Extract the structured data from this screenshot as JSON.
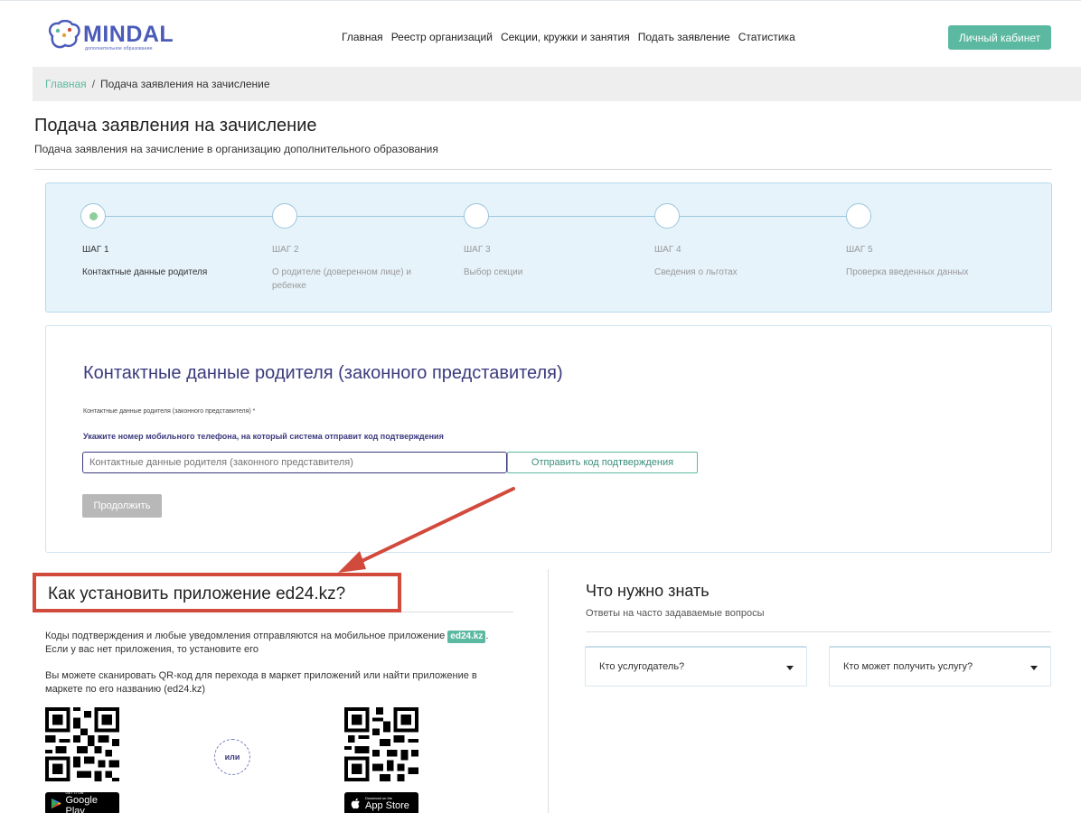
{
  "header": {
    "logo_name": "MINDAL",
    "logo_sub": "дополнительное образование",
    "nav": [
      "Главная",
      "Реестр организаций",
      "Секции, кружки и занятия",
      "Подать заявление",
      "Статистика"
    ],
    "cabinet_button": "Личный кабинет"
  },
  "breadcrumb": {
    "home": "Главная",
    "separator": "/",
    "current": "Подача заявления на зачисление"
  },
  "page": {
    "title": "Подача заявления на зачисление",
    "subtitle": "Подача заявления на зачисление в организацию дополнительного образования"
  },
  "steps": [
    {
      "label": "ШАГ 1",
      "desc": "Контактные данные родителя",
      "active": true
    },
    {
      "label": "ШАГ 2",
      "desc": "О родителе (доверенном лице) и ребенке",
      "active": false
    },
    {
      "label": "ШАГ 3",
      "desc": "Выбор секции",
      "active": false
    },
    {
      "label": "ШАГ 4",
      "desc": "Сведения о льготах",
      "active": false
    },
    {
      "label": "ШАГ 5",
      "desc": "Проверка введенных данных",
      "active": false
    }
  ],
  "form": {
    "title": "Контактные данные родителя (законного представителя)",
    "field_label": "Контактные данные родителя (законного представителя) *",
    "hint": "Укажите номер мобильного телефона, на который система отправит код подтверждения",
    "phone_placeholder": "Контактные данные родителя (законного представителя)",
    "send_code_button": "Отправить код подтверждения",
    "continue_button": "Продолжить"
  },
  "install": {
    "title": "Как установить приложение ed24.kz?",
    "text1_before": "Коды подтверждения и любые уведомления отправляются на мобильное приложение",
    "badge": "ed24.kz",
    "text1_after": ". Если у вас нет приложения, то установите его",
    "text2": "Вы можете сканировать QR-код для перехода в маркет приложений или найти приложение в маркете по его названию (ed24.kz)",
    "or": "или",
    "google_play_small": "GET IT ON",
    "google_play": "Google Play",
    "app_store_small": "Download on the",
    "app_store": "App Store"
  },
  "faq": {
    "title": "Что нужно знать",
    "subtitle": "Ответы на часто задаваемые вопросы",
    "items": [
      "Кто услугодатель?",
      "Кто может получить услугу?"
    ]
  },
  "colors": {
    "accent_green": "#5cb9a1",
    "brand_blue": "#4a5bb8",
    "form_title": "#3c3a7e",
    "annotation_red": "#d24a3c",
    "steps_bg": "#e6f3fb"
  },
  "icons": {
    "logo": "mindal-logo-icon",
    "faq_caret": "caret-down-icon",
    "google_play": "google-play-icon",
    "app_store": "apple-icon",
    "qr": "qr-code-icon"
  }
}
